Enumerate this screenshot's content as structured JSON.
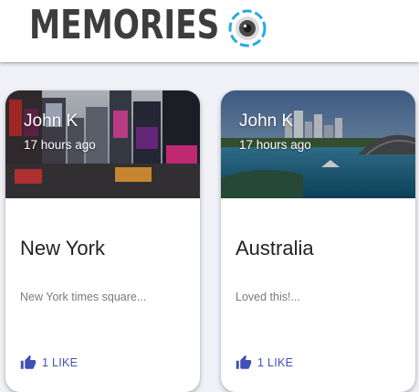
{
  "header": {
    "brand": "Memories",
    "logo_icon": "camera-lens-icon",
    "accent": "#29a9e1"
  },
  "posts": [
    {
      "author": "John K",
      "time": "17 hours ago",
      "title": "New York",
      "message": "New York times square...",
      "like_label": "1 LIKE",
      "like_icon": "thumb-up-icon"
    },
    {
      "author": "John K",
      "time": "17 hours ago",
      "title": "Australia",
      "message": "Loved this!...",
      "like_label": "1 LIKE",
      "like_icon": "thumb-up-icon"
    }
  ],
  "colors": {
    "like": "#3f51b5",
    "title": "#222222",
    "message": "#7a7a7a"
  }
}
